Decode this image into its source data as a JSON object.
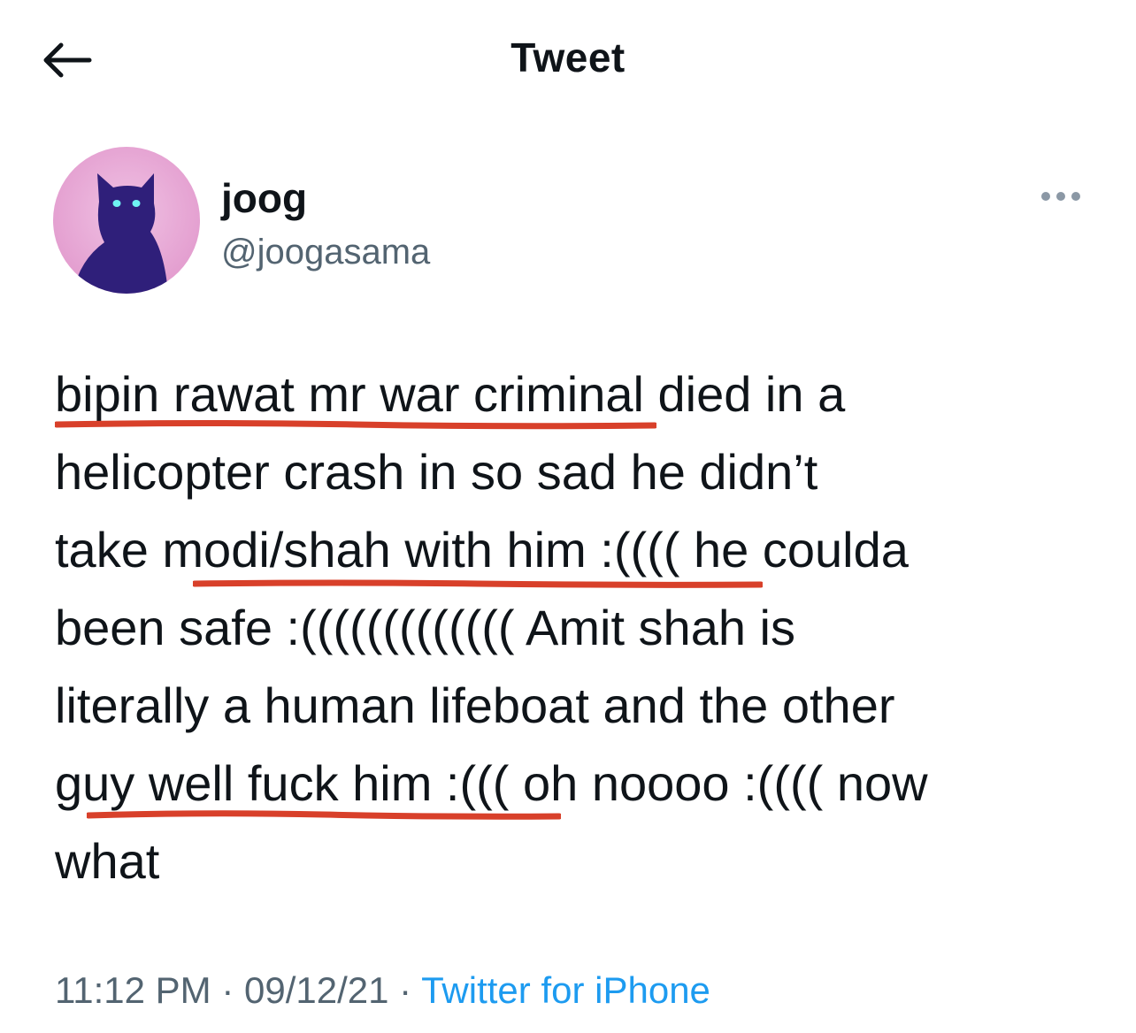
{
  "header": {
    "title": "Tweet",
    "back_icon": "arrow-left-icon"
  },
  "author": {
    "name": "joog",
    "handle": "@joogasama",
    "avatar_icon": "cat-silhouette-avatar",
    "more_icon": "more-horizontal-icon"
  },
  "tweet": {
    "lines": [
      "bipin rawat mr war criminal died in a",
      "helicopter crash in so sad he didn’t",
      "take modi/shah with him :(((( he coulda",
      "been safe :((((((((((((( Amit shah is",
      "literally a human lifeboat and the other",
      "guy well fuck him :((( oh noooo :(((( now",
      "what"
    ]
  },
  "meta": {
    "time": "11:12 PM",
    "separator": "·",
    "date": "09/12/21",
    "source": "Twitter for iPhone"
  },
  "colors": {
    "text": "#0f1419",
    "secondary": "#536471",
    "link": "#1d9bf0",
    "annotation": "#d8402a",
    "avatar_bg": "#e7a6d6",
    "cat": "#2f1f7a",
    "cat_eyes": "#6ff4f2"
  }
}
